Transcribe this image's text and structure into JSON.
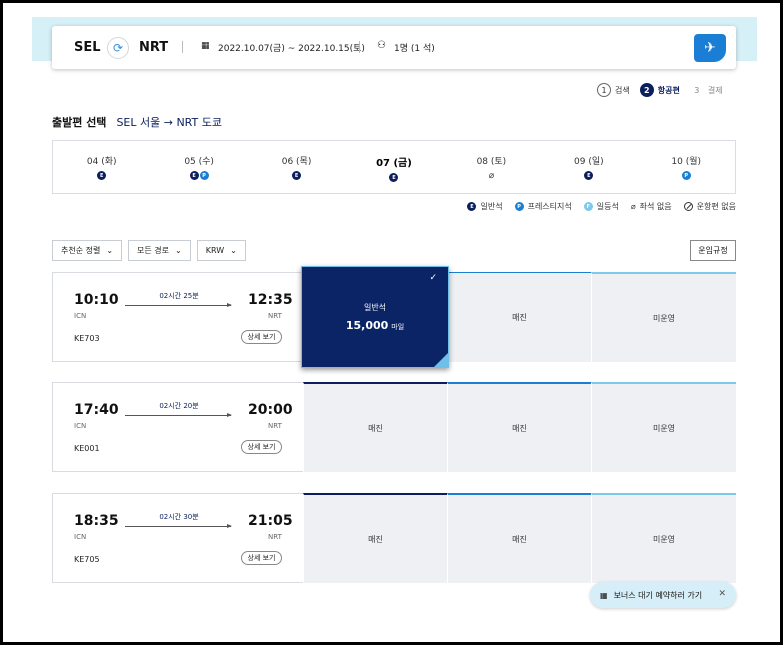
{
  "search": {
    "from": "SEL",
    "to": "NRT",
    "dates": "2022.10.07(금) ~ 2022.10.15(토)",
    "passengers": "1명 (1 석)"
  },
  "steps": [
    {
      "num": "1",
      "label": "검색"
    },
    {
      "num": "2",
      "label": "항공편"
    },
    {
      "num": "3",
      "label": "결제"
    }
  ],
  "title": {
    "label": "출발편 선택",
    "route": "SEL 서울 → NRT 도쿄"
  },
  "dates": [
    {
      "label": "04 (화)",
      "badges": [
        "E"
      ]
    },
    {
      "label": "05 (수)",
      "badges": [
        "E",
        "P"
      ]
    },
    {
      "label": "06 (목)",
      "badges": [
        "E"
      ]
    },
    {
      "label": "07 (금)",
      "badges": [
        "E"
      ]
    },
    {
      "label": "08 (토)",
      "badges": []
    },
    {
      "label": "09 (일)",
      "badges": [
        "E"
      ]
    },
    {
      "label": "10 (월)",
      "badges": [
        "P"
      ]
    }
  ],
  "legend": {
    "economy": "일반석",
    "prestige": "프레스티지석",
    "first": "일등석",
    "no_seat": "좌석 없음",
    "no_flight": "운항편 없음"
  },
  "filters": {
    "sort": "추천순 정렬",
    "route": "모든 경로",
    "currency": "KRW",
    "rules": "운임규정"
  },
  "flights": [
    {
      "dep_time": "10:10",
      "dep_ap": "ICN",
      "arr_time": "12:35",
      "arr_ap": "NRT",
      "duration": "02시간 25분",
      "flight_no": "KE703",
      "detail": "상세 보기",
      "c1": "일반석",
      "c1_miles": "15,000",
      "c1_unit": "마일",
      "c2": "매진",
      "c3": "미운영"
    },
    {
      "dep_time": "17:40",
      "dep_ap": "ICN",
      "arr_time": "20:00",
      "arr_ap": "NRT",
      "duration": "02시간 20분",
      "flight_no": "KE001",
      "detail": "상세 보기",
      "c1": "매진",
      "c2": "매진",
      "c3": "미운영"
    },
    {
      "dep_time": "18:35",
      "dep_ap": "ICN",
      "arr_time": "21:05",
      "arr_ap": "NRT",
      "duration": "02시간 30분",
      "flight_no": "KE705",
      "detail": "상세 보기",
      "c1": "매진",
      "c2": "매진",
      "c3": "미운영"
    }
  ],
  "bonus": {
    "label": "보너스 대기 예약하러 가기"
  },
  "colors": {
    "navy": "#0a1f5c",
    "blue": "#1a7fd4",
    "lightblue": "#7dc9ec",
    "band": "#d6f0f8"
  }
}
